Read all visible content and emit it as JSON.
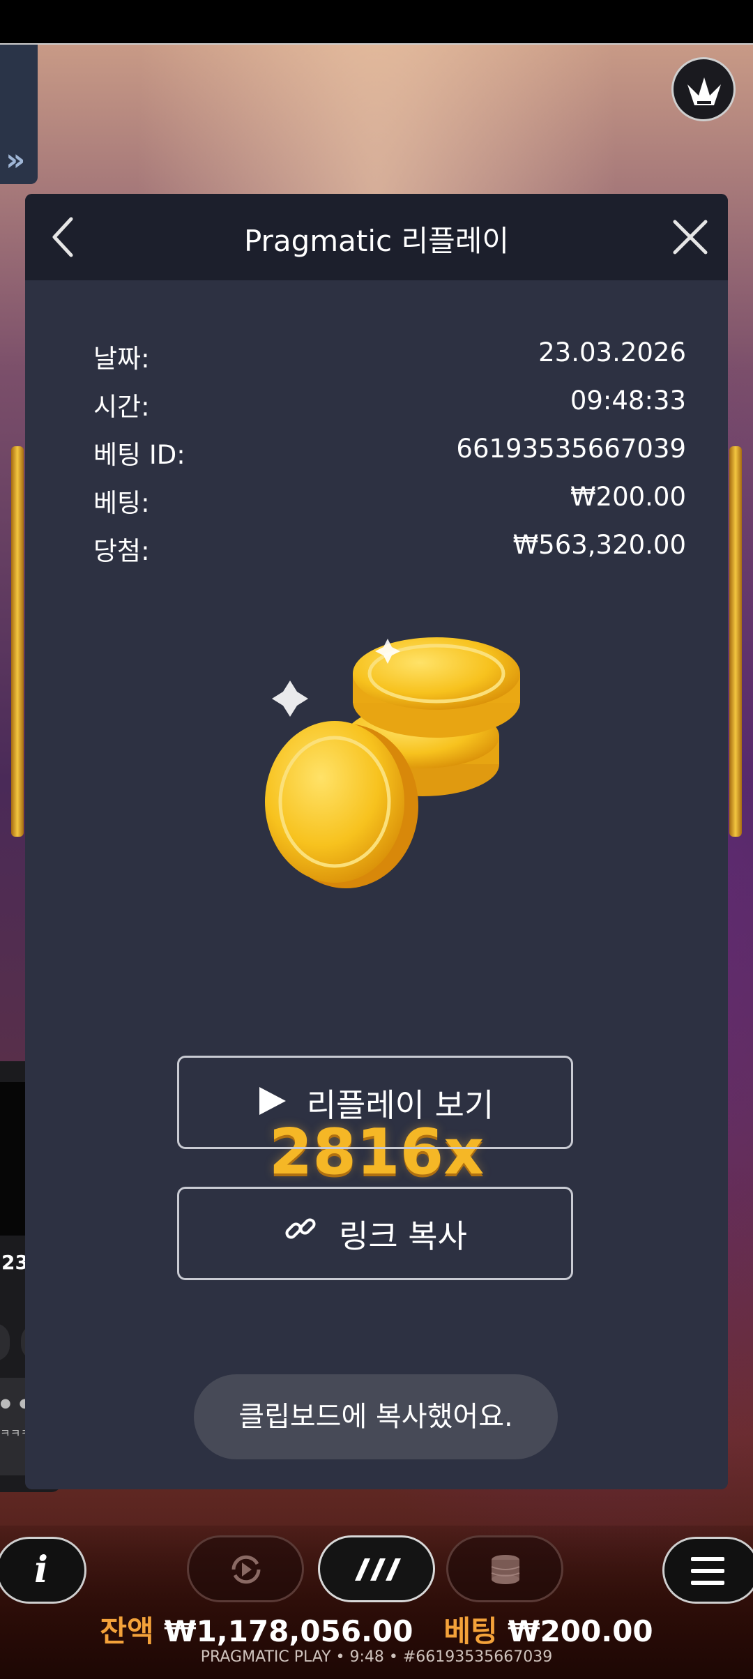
{
  "modal": {
    "title": "Pragmatic 리플레이",
    "rows": [
      {
        "label": "날짜:",
        "value": "23.03.2026"
      },
      {
        "label": "시간:",
        "value": "09:48:33"
      },
      {
        "label": "베팅 ID:",
        "value": "66193535667039"
      },
      {
        "label": "베팅:",
        "value": "₩200.00"
      },
      {
        "label": "당첨:",
        "value": "₩563,320.00"
      }
    ],
    "multiplier": "2816x",
    "replay_button": "리플레이 보기",
    "copy_link_button": "링크 복사"
  },
  "toast": "클립보드에 복사했어요.",
  "floating_card": {
    "text": "23...",
    "chip_text": "✂ ≡"
  },
  "bottom_bar": {
    "info_label": "i",
    "balance_label": "잔액",
    "balance_value": "₩1,178,056.00",
    "bet_label": "베팅",
    "bet_value": "₩200.00",
    "footer": "PRAGMATIC PLAY • 9:48 • #66193535667039"
  },
  "colors": {
    "modal_bg": "#2d3142",
    "header_bg": "#1c1f2c",
    "gold": "#f5b726",
    "balance_label": "#f4a23a"
  },
  "icons": [
    "back-chevron-icon",
    "close-icon",
    "play-icon",
    "link-icon",
    "gold-coins-icon",
    "pragmatic-logo-icon",
    "autoplay-icon",
    "spin-icon",
    "coins-stack-icon",
    "menu-icon",
    "double-chevron-icon"
  ]
}
